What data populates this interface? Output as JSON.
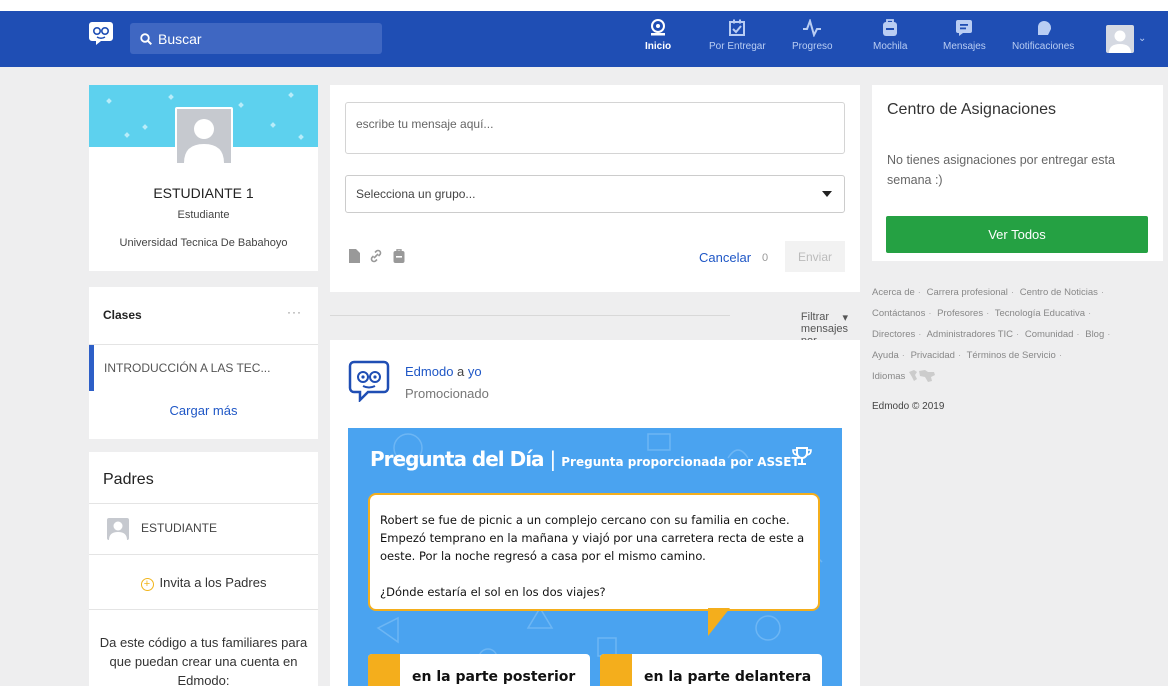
{
  "nav": {
    "search_placeholder": "Buscar",
    "items": [
      {
        "label": "Inicio",
        "icon": "home-icon",
        "active": true
      },
      {
        "label": "Por Entregar",
        "icon": "calendar-check-icon",
        "active": false
      },
      {
        "label": "Progreso",
        "icon": "pulse-icon",
        "active": false
      },
      {
        "label": "Mochila",
        "icon": "backpack-icon",
        "active": false
      },
      {
        "label": "Mensajes",
        "icon": "message-icon",
        "active": false
      },
      {
        "label": "Notificaciones",
        "icon": "bell-icon",
        "active": false
      }
    ],
    "accent": "#1f4eb4"
  },
  "profile": {
    "name": "ESTUDIANTE 1",
    "role": "Estudiante",
    "university": "Universidad Tecnica De Babahoyo"
  },
  "classes": {
    "title": "Clases",
    "more": "···",
    "items": [
      {
        "label": "INTRODUCCIÓN A LAS TEC..."
      }
    ],
    "load_more": "Cargar más"
  },
  "parents": {
    "title": "Padres",
    "student": "ESTUDIANTE",
    "invite": "Invita a los Padres",
    "code_text": "Da este código a tus familiares para que puedan crear una cuenta en Edmodo:"
  },
  "composer": {
    "placeholder": "escribe tu mensaje aquí...",
    "group_select": "Selecciona un grupo...",
    "cancel": "Cancelar",
    "counter": "0",
    "send": "Enviar"
  },
  "filter": {
    "label": "Filtrar mensajes por"
  },
  "post": {
    "author": "Edmodo",
    "connector": " a ",
    "recipient": "yo",
    "promoted": "Promocionado",
    "question": {
      "title": "Pregunta del Día",
      "subtitle": "Pregunta proporcionada por ASSET",
      "text": "Robert se fue de picnic a un complejo cercano con su familia en coche. Empezó temprano en la mañana y viajó por una carretera recta de este a oeste. Por la noche regresó a casa por el mismo camino.",
      "ask": "¿Dónde estaría el sol en los dos viajes?",
      "answers": [
        "en la parte posterior",
        "en la parte delantera"
      ]
    }
  },
  "assignments": {
    "title": "Centro de Asignaciones",
    "message": "No tienes asignaciones por entregar esta semana :)",
    "button": "Ver Todos",
    "button_color": "#25a143"
  },
  "footer": {
    "links": [
      "Acerca de",
      "Carrera profesional",
      "Centro de Noticias",
      "Contáctanos",
      "Profesores",
      "Tecnología Educativa",
      "Directores",
      "Administradores TIC",
      "Comunidad",
      "Blog",
      "Ayuda",
      "Privacidad",
      "Términos de Servicio",
      "Idiomas"
    ],
    "copyright": "Edmodo © 2019"
  }
}
